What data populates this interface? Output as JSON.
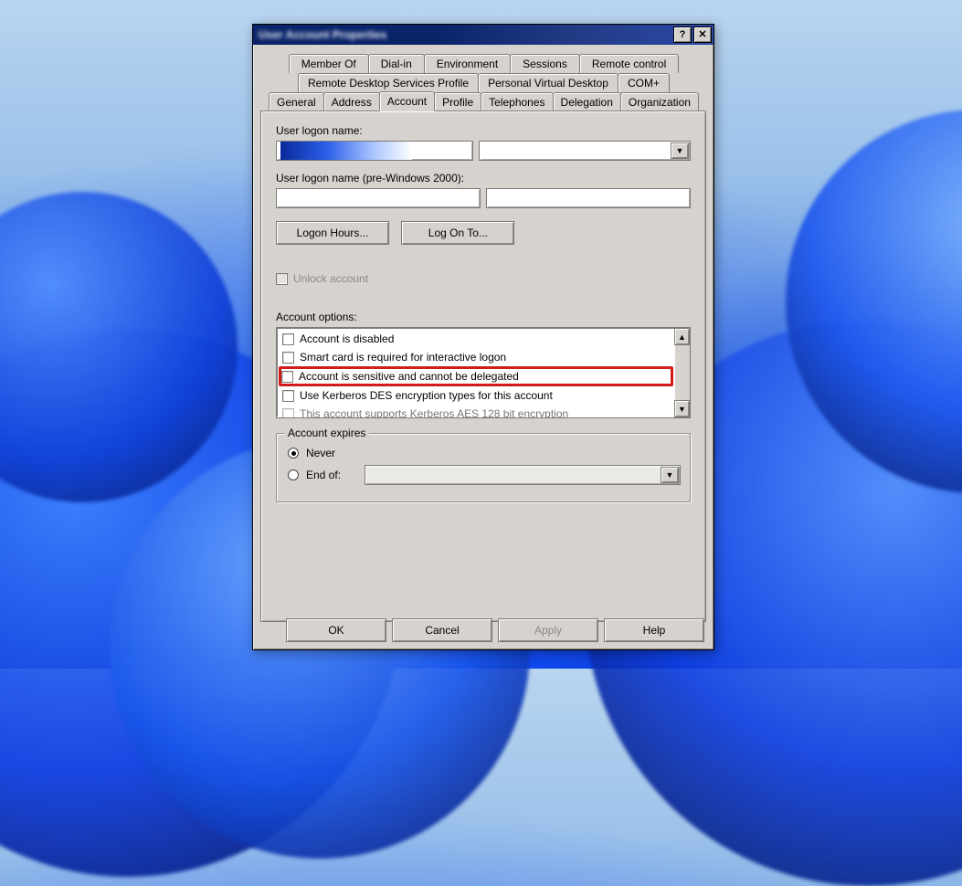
{
  "title": "User Account Properties",
  "titlebar": {
    "help_sym": "?",
    "close_sym": "✕"
  },
  "tabs": {
    "row1": [
      "Member Of",
      "Dial-in",
      "Environment",
      "Sessions",
      "Remote control"
    ],
    "row2": [
      "Remote Desktop Services Profile",
      "Personal Virtual Desktop",
      "COM+"
    ],
    "row3": [
      "General",
      "Address",
      "Account",
      "Profile",
      "Telephones",
      "Delegation",
      "Organization"
    ],
    "selected": "Account"
  },
  "account": {
    "logon_label": "User logon name:",
    "upn_value": "",
    "upn_suffix_sel": "",
    "prew2k_label": "User logon name (pre-Windows 2000):",
    "prew2k_domain": "",
    "prew2k_name": "",
    "logon_hours_btn": "Logon Hours...",
    "log_on_to_btn": "Log On To...",
    "unlock_label": "Unlock account",
    "options_label": "Account options:",
    "options": [
      "Account is disabled",
      "Smart card is required for interactive logon",
      "Account is sensitive and cannot be delegated",
      "Use Kerberos DES encryption types for this account",
      "This account supports Kerberos AES 128 bit encryption"
    ],
    "expires_legend": "Account expires",
    "never_label": "Never",
    "endof_label": "End of:",
    "endof_value": ""
  },
  "buttons": {
    "ok": "OK",
    "cancel": "Cancel",
    "apply": "Apply",
    "help": "Help"
  },
  "glyphs": {
    "down": "▼",
    "up": "▲"
  }
}
